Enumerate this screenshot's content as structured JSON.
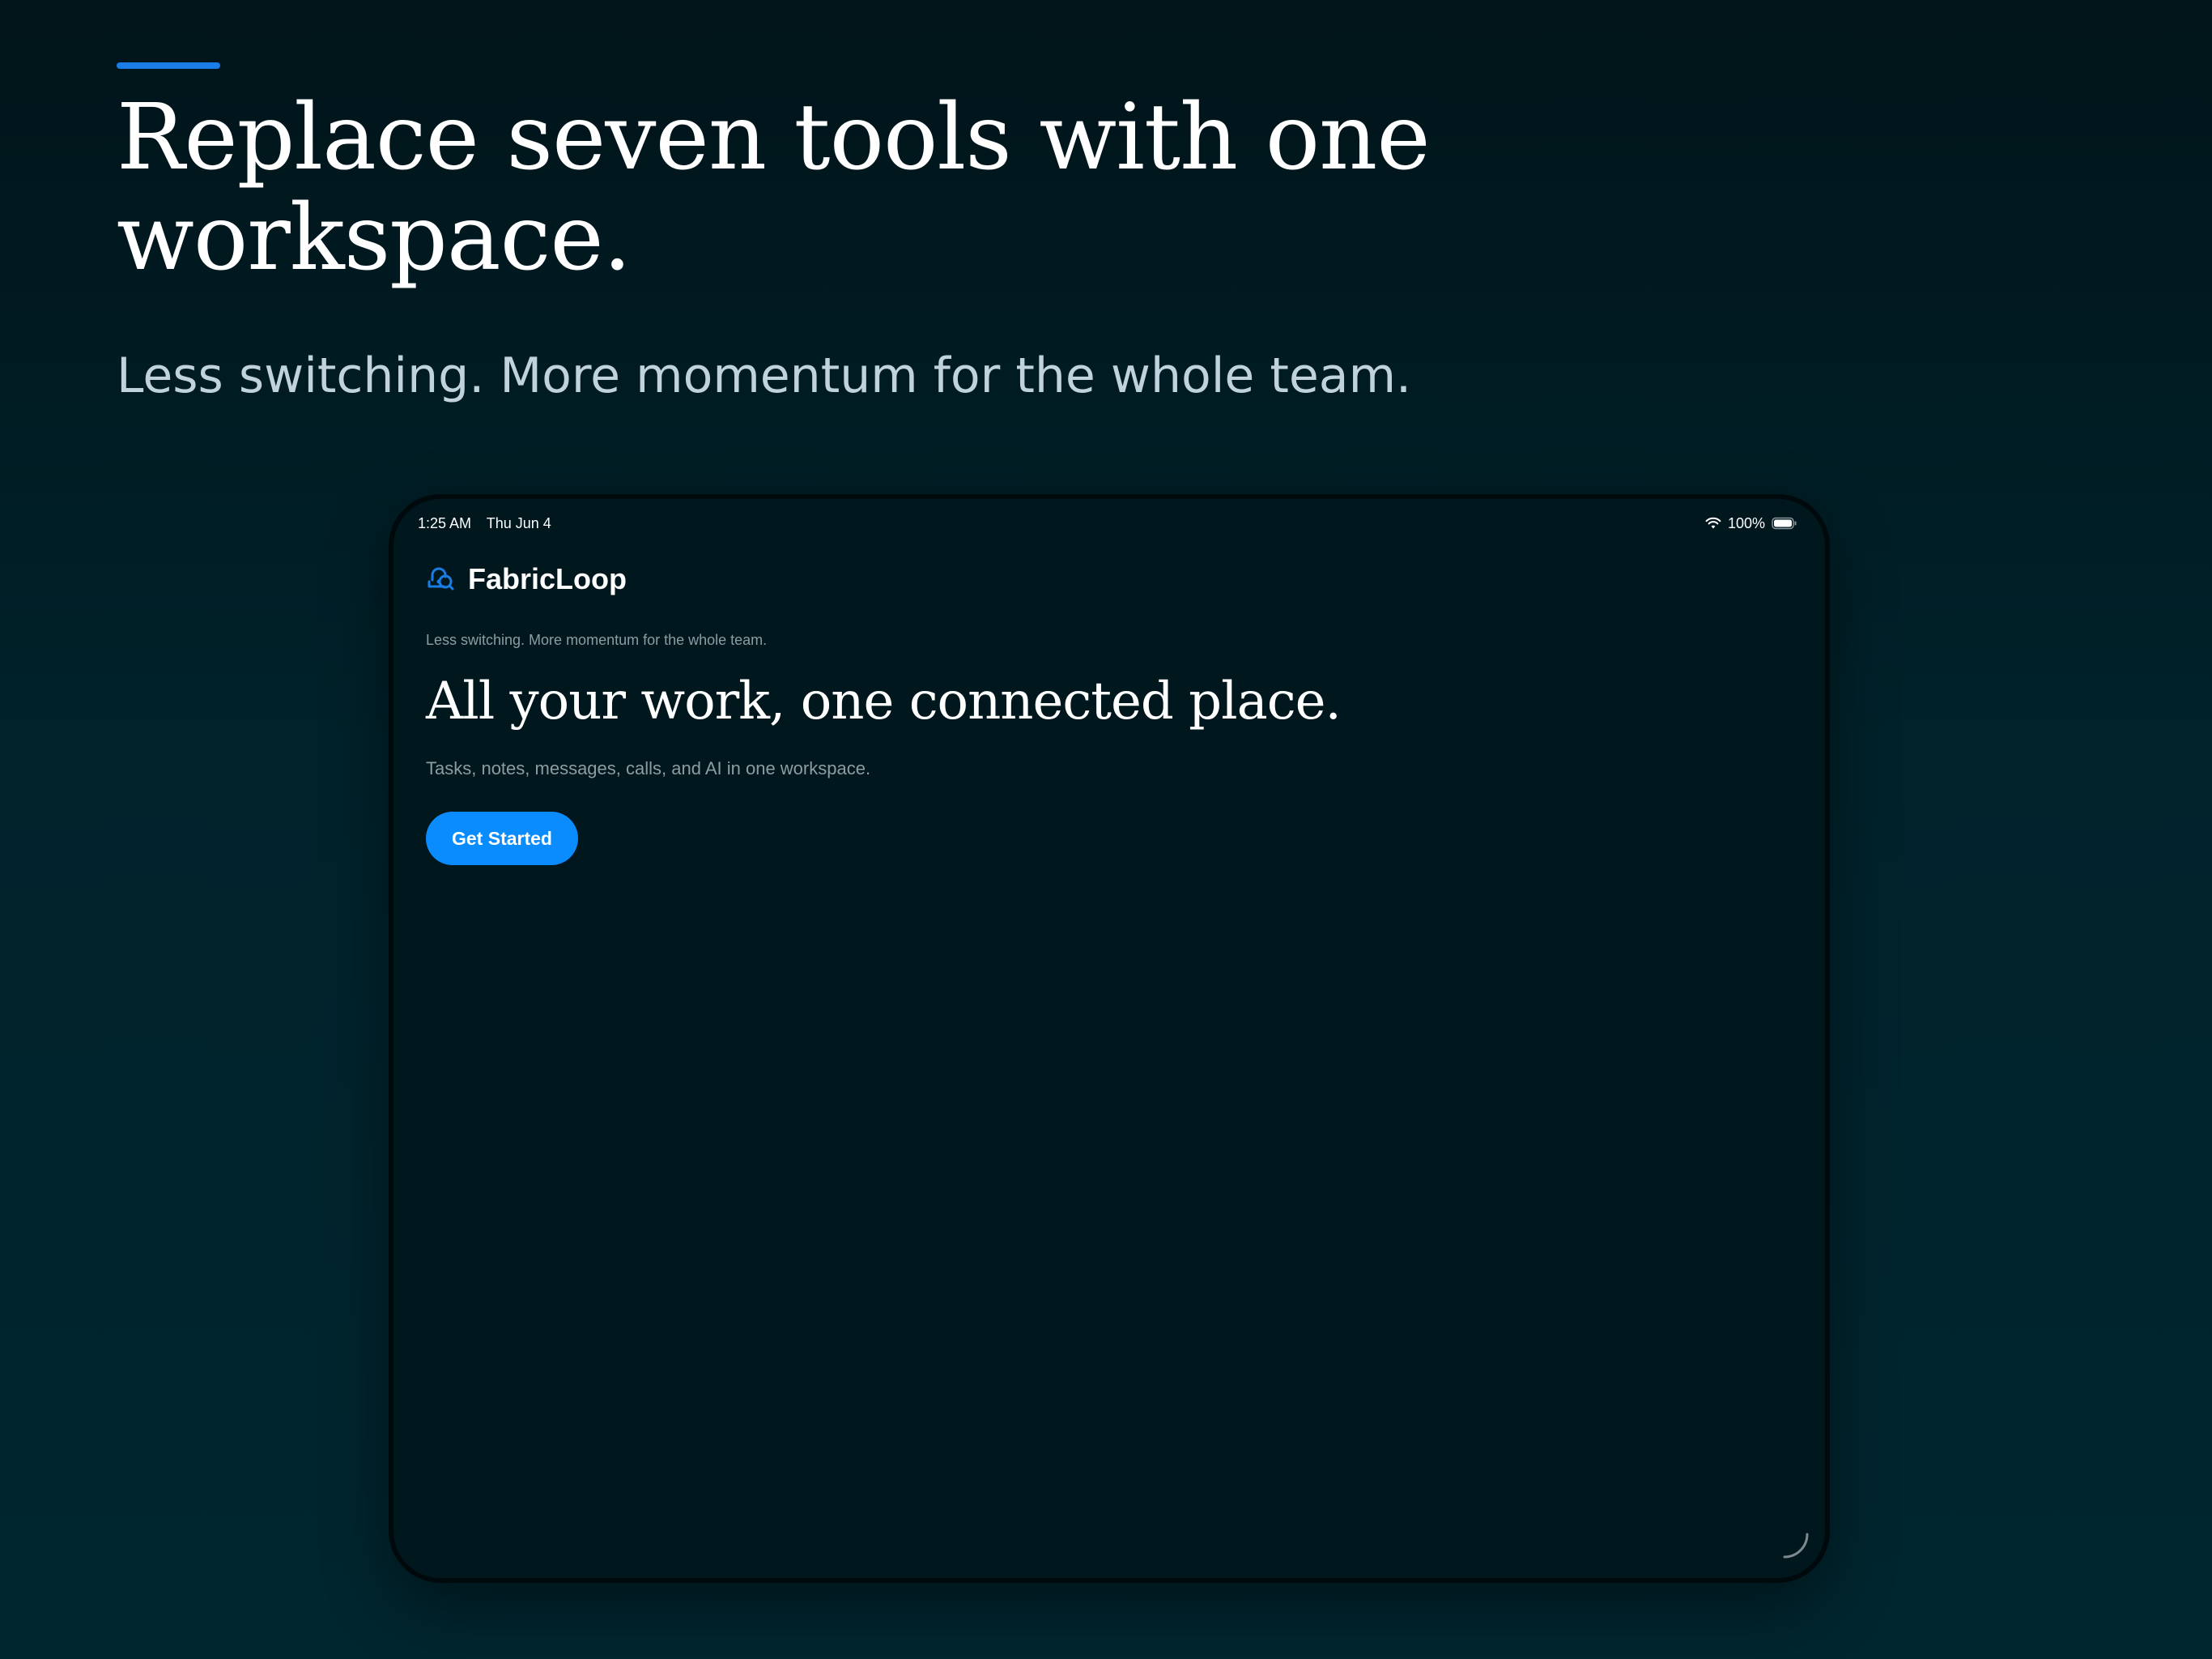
{
  "page": {
    "headline": "Replace seven tools with one workspace.",
    "subhead": "Less switching. More momentum for the whole team."
  },
  "device": {
    "status_bar": {
      "time": "1:25 AM",
      "date": "Thu Jun 4",
      "battery": "100%",
      "icons": [
        "wifi-icon",
        "battery-icon"
      ]
    },
    "app": {
      "brand_name": "FabricLoop",
      "brand_icon": "fabricloop-logo-icon",
      "tagline": "Less switching. More momentum for the whole team.",
      "hero_title": "All your work, one connected place.",
      "hero_description": "Tasks, notes, messages, calls, and AI in one workspace.",
      "cta_label": "Get Started"
    }
  },
  "colors": {
    "accent": "#1a7de6",
    "button": "#0a8cff",
    "background_top": "#001419",
    "background_bottom": "#002630",
    "screen": "#00171e"
  }
}
